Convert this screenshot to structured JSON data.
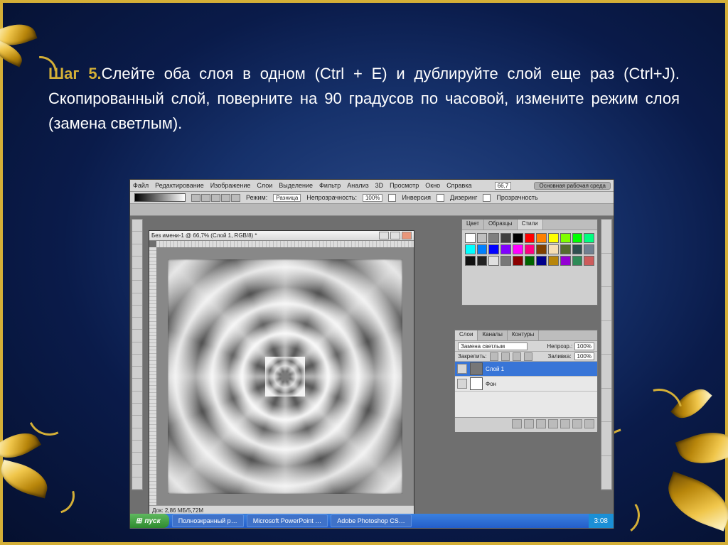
{
  "instruction": {
    "step_label": "Шаг 5.",
    "text": "Слейте оба слоя в одном (Ctrl + E) и дублируйте слой еще раз (Ctrl+J). Скопированный слой, поверните на 90 градусов по часовой, измените режим слоя (замена светлым)."
  },
  "photoshop": {
    "menu": [
      "Файл",
      "Редактирование",
      "Изображение",
      "Слои",
      "Выделение",
      "Фильтр",
      "Анализ",
      "3D",
      "Просмотр",
      "Окно",
      "Справка"
    ],
    "zoom_field": "66,7",
    "workspace": "Основная рабочая среда",
    "optbar": {
      "tool_label": "Режим:",
      "mode_value": "Разница",
      "opacity_label": "Непрозрачность:",
      "opacity_value": "100%",
      "chk_inverse": "Инверсия",
      "chk_dither": "Дизеринг",
      "chk_transparency": "Прозрачность"
    },
    "document": {
      "title": "Без имени-1 @ 66,7% (Слой 1, RGB/8) *",
      "status": "Док: 2,86 МБ/5,72M"
    },
    "swatches": {
      "tabs": [
        "Цвет",
        "Образцы",
        "Стили"
      ],
      "active": "Стили",
      "colors": [
        "#ffffff",
        "#c0c0c0",
        "#808080",
        "#404040",
        "#000000",
        "#ff0000",
        "#ff8000",
        "#ffff00",
        "#80ff00",
        "#00ff00",
        "#00ff80",
        "#00ffff",
        "#0080ff",
        "#0000ff",
        "#8000ff",
        "#ff00ff",
        "#ff0080",
        "#804000",
        "#f5deb3",
        "#556b2f",
        "#2f4f4f",
        "#708090",
        "#111111",
        "#222222",
        "#e0e0e0",
        "#777777",
        "#8b0000",
        "#006400",
        "#00008b",
        "#b8860b",
        "#9400d3",
        "#2e8b57",
        "#cd5c5c"
      ]
    },
    "layers": {
      "tabs": [
        "Слои",
        "Каналы",
        "Контуры"
      ],
      "active": "Слои",
      "blend_mode": "Замена светлым",
      "opacity_label": "Непрозр.:",
      "opacity_value": "100%",
      "lock_label": "Закрепить:",
      "fill_label": "Заливка:",
      "fill_value": "100%",
      "rows": [
        {
          "name": "Слой 1",
          "selected": true
        },
        {
          "name": "Фон",
          "selected": false
        }
      ]
    }
  },
  "taskbar": {
    "start": "пуск",
    "items": [
      "Полноэкранный р…",
      "Microsoft PowerPoint …",
      "Adobe Photoshop CS…"
    ],
    "time": "3:08"
  }
}
